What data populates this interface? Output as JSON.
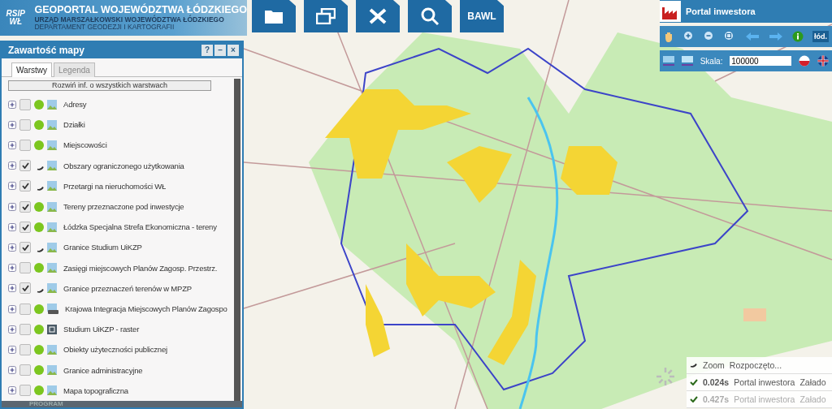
{
  "header": {
    "logo_text": "RSIP WŁ",
    "title": "GEOPORTAL WOJEWÓDZTWA ŁÓDZKIEGO",
    "subtitle": "URZĄD MARSZAŁKOWSKI WOJEWÓDZTWA ŁÓDZKIEGO",
    "department": "DEPARTAMENT GEODEZJI I KARTOGRAFII"
  },
  "toolbar": [
    {
      "kind": "folder"
    },
    {
      "kind": "windows"
    },
    {
      "kind": "tools"
    },
    {
      "kind": "search"
    },
    {
      "kind": "text",
      "label": "BAWL"
    }
  ],
  "panel": {
    "title": "Zawartość mapy",
    "buttons": [
      "?",
      "–",
      "×"
    ],
    "tabs": [
      {
        "label": "Warstwy",
        "selected": true
      },
      {
        "label": "Legenda",
        "selected": false
      }
    ],
    "expand_button": "Rozwiń inf. o wszystkich warstwach",
    "layers": [
      {
        "name": "Adresy",
        "checked": false,
        "loading": false,
        "kind": "image"
      },
      {
        "name": "Działki",
        "checked": false,
        "loading": false,
        "kind": "image"
      },
      {
        "name": "Miejscowości",
        "checked": false,
        "loading": false,
        "kind": "image"
      },
      {
        "name": "Obszary ograniczonego użytkowania",
        "checked": true,
        "loading": true,
        "kind": "image"
      },
      {
        "name": "Przetargi na nieruchomości WŁ",
        "checked": true,
        "loading": true,
        "kind": "image"
      },
      {
        "name": "Tereny przeznaczone pod inwestycje",
        "checked": true,
        "loading": false,
        "kind": "image"
      },
      {
        "name": "Łódzka Specjalna Strefa Ekonomiczna - tereny",
        "checked": true,
        "loading": false,
        "kind": "image"
      },
      {
        "name": "Granice Studium UiKZP",
        "checked": true,
        "loading": true,
        "kind": "image"
      },
      {
        "name": "Zasięgi miejscowych Planów Zagosp. Przestrz.",
        "checked": false,
        "loading": false,
        "kind": "image"
      },
      {
        "name": "Granice przeznaczeń terenów w MPZP",
        "checked": true,
        "loading": true,
        "kind": "image"
      },
      {
        "name": "Krajowa Integracja Miejscowych Planów Zagospo",
        "checked": false,
        "loading": false,
        "kind": "wms"
      },
      {
        "name": "Studium UiKZP - raster",
        "checked": false,
        "loading": false,
        "kind": "raster"
      },
      {
        "name": "Obiekty użyteczności publicznej",
        "checked": false,
        "loading": false,
        "kind": "image"
      },
      {
        "name": "Granice administracyjne",
        "checked": false,
        "loading": false,
        "kind": "image"
      },
      {
        "name": "Mapa topograficzna",
        "checked": false,
        "loading": false,
        "kind": "image"
      }
    ],
    "footer": "PROGRAM"
  },
  "portal": {
    "title": "Portal inwestora",
    "tools": [
      {
        "kind": "hand"
      },
      {
        "kind": "zoom-in"
      },
      {
        "kind": "zoom-out"
      },
      {
        "kind": "zoom-extent"
      },
      {
        "kind": "back"
      },
      {
        "kind": "forward"
      },
      {
        "kind": "info"
      },
      {
        "kind": "badge",
        "label": "łód."
      }
    ],
    "scale_label": "Skala:",
    "scale_value": "100000",
    "languages": [
      {
        "kind": "pl"
      },
      {
        "kind": "en"
      }
    ]
  },
  "log": [
    {
      "kind": "progress",
      "col_1": "Zoom",
      "col_2": "Rozpoczęto..."
    },
    {
      "kind": "done",
      "time": "0.024s",
      "source": "Portal inwestora",
      "message": "Załado",
      "faded": false
    },
    {
      "kind": "done",
      "time": "0.427s",
      "source": "Portal inwestora",
      "message": "Załado",
      "faded": true
    }
  ]
}
